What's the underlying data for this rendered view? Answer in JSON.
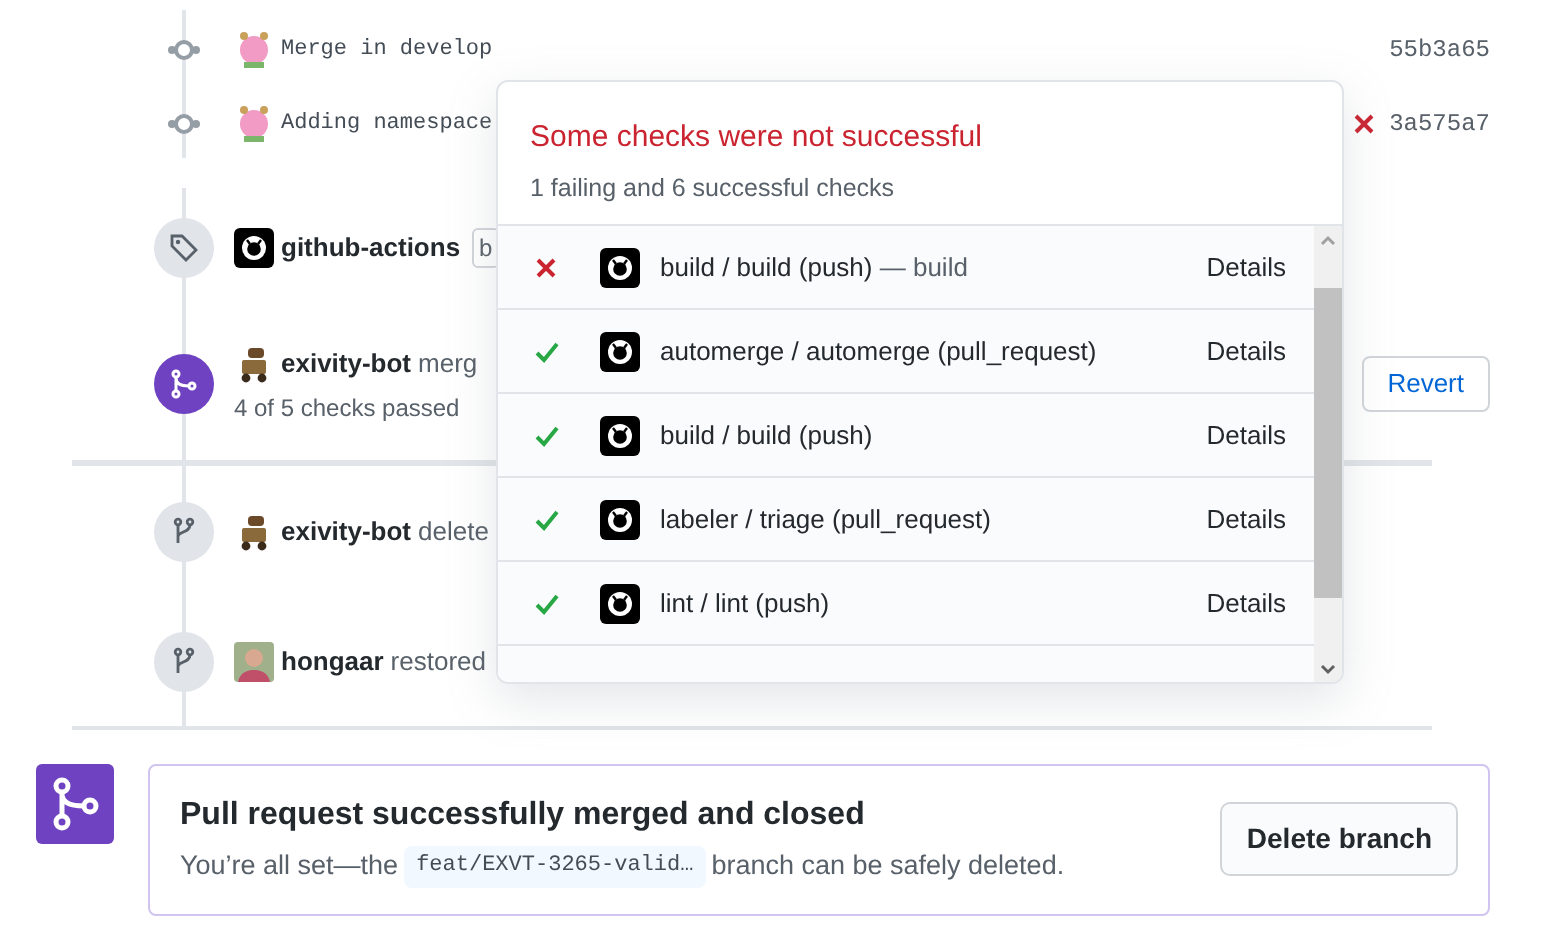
{
  "timeline": [
    {
      "kind": "commit",
      "message": "Merge in develop",
      "sha": "55b3a65",
      "failed": false
    },
    {
      "kind": "commit",
      "message": "Adding namespace",
      "sha": "3a575a7",
      "failed": true
    },
    {
      "kind": "tag",
      "actor": "github-actions",
      "label": "b"
    },
    {
      "kind": "merged",
      "actor": "exivity-bot",
      "action": "merg",
      "checks": "4 of 5 checks passed",
      "button": "Revert"
    },
    {
      "kind": "deleted",
      "actor": "exivity-bot",
      "action": "delete"
    },
    {
      "kind": "restored",
      "actor": "hongaar",
      "action": "restored"
    }
  ],
  "popover": {
    "title": "Some checks were not successful",
    "subtitle": "1 failing and 6 successful checks",
    "checks": [
      {
        "name": "build / build (push)",
        "suffix": "— build",
        "passed": false,
        "link": "Details"
      },
      {
        "name": "automerge / automerge (pull_request)",
        "passed": true,
        "link": "Details"
      },
      {
        "name": "build / build (push)",
        "passed": true,
        "link": "Details"
      },
      {
        "name": "labeler / triage (pull_request)",
        "passed": true,
        "link": "Details"
      },
      {
        "name": "lint / lint (push)",
        "passed": true,
        "link": "Details"
      }
    ]
  },
  "merge_box": {
    "title": "Pull request successfully merged and closed",
    "text_before": "You’re all set—the",
    "branch": "feat/EXVT-3265-valid…",
    "text_after": "branch can be safely deleted.",
    "button": "Delete branch"
  }
}
